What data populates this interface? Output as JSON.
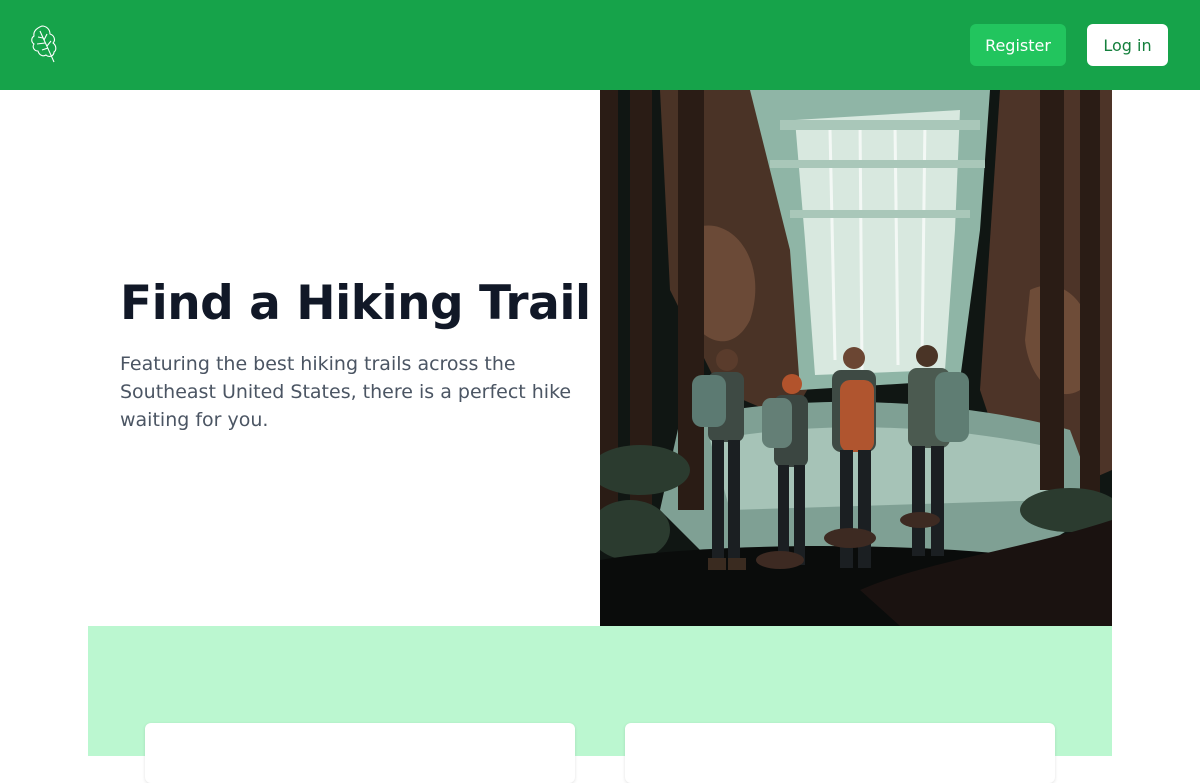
{
  "header": {
    "logo_icon": "leaf-icon",
    "register_label": "Register",
    "login_label": "Log in",
    "brand_color": "#16a34a"
  },
  "hero": {
    "title": "Find a Hiking Trail",
    "subtitle": "Featuring the best hiking trails across the Southeast United States, there is a perfect hike waiting for you.",
    "image_subject": "hikers-at-waterfall-illustration"
  },
  "features": {
    "background_color": "#bbf7d0",
    "cards": [
      {
        "id": "card-1"
      },
      {
        "id": "card-2"
      }
    ]
  }
}
